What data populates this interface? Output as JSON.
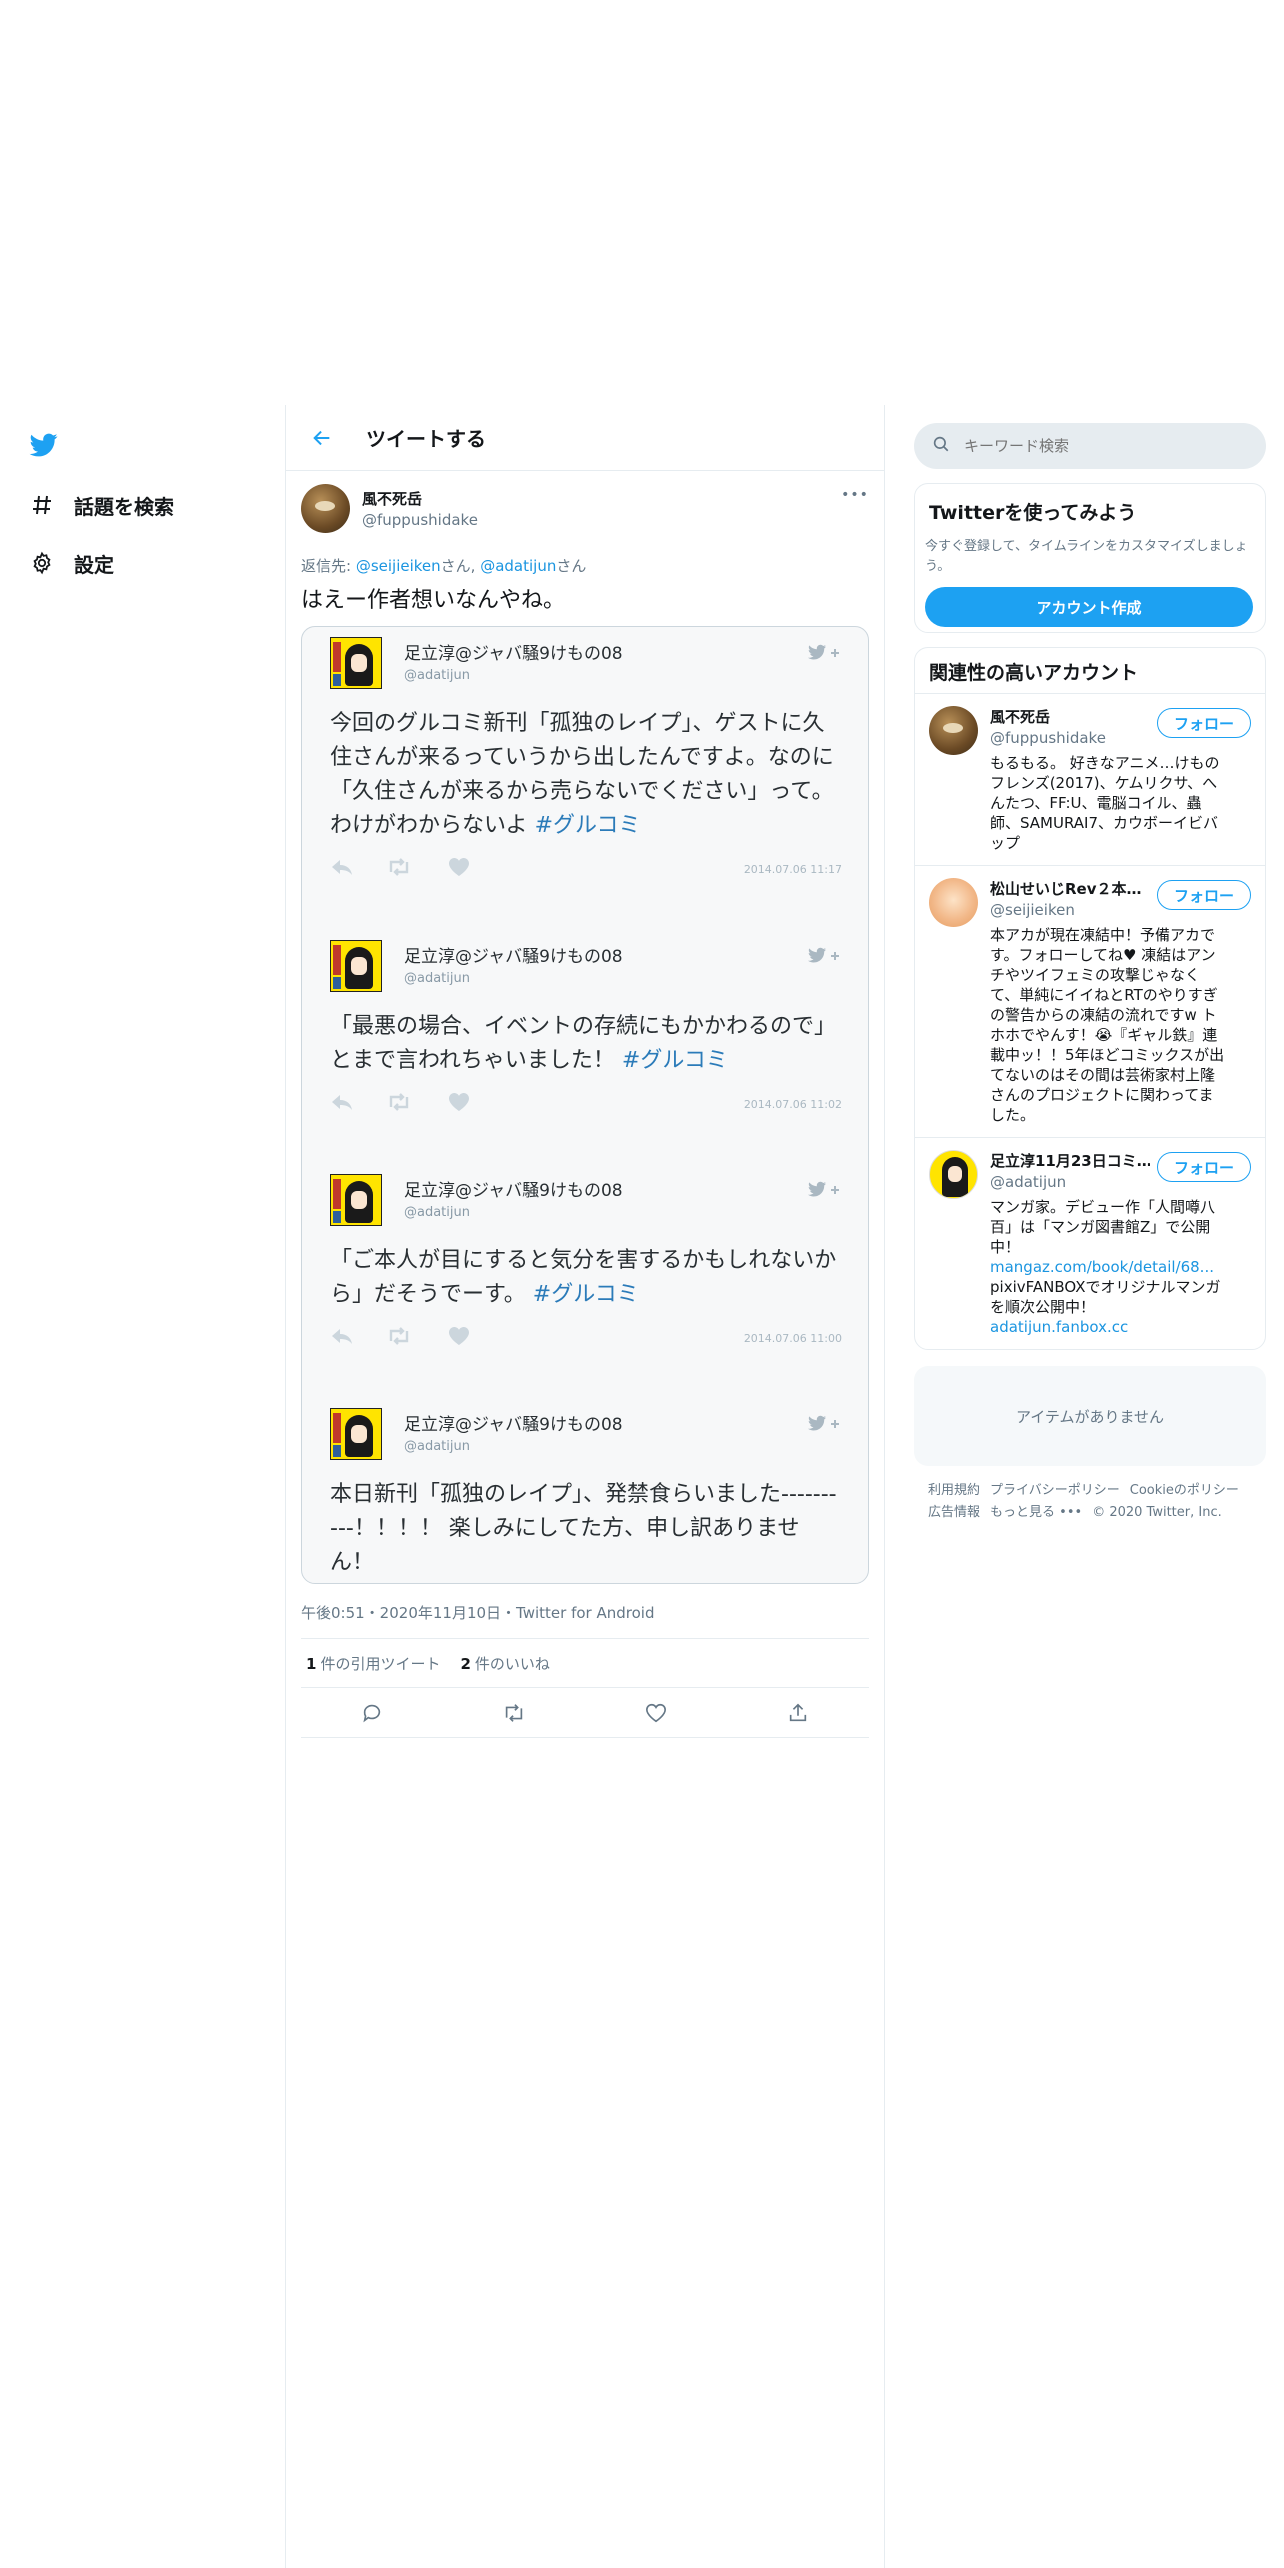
{
  "nav": {
    "explore_label": "話題を検索",
    "settings_label": "設定"
  },
  "header": {
    "title": "ツイートする"
  },
  "tweet": {
    "author_name": "風不死岳",
    "author_handle": "@fuppushidake",
    "more_glyph": "•••",
    "reply_prefix": "返信先: ",
    "reply_user1": "@seijieiken",
    "reply_suffix1": "さん, ",
    "reply_user2": "@adatijun",
    "reply_suffix2": "さん",
    "text": "はえー作者想いなんやね。",
    "timestamp": "午後0:51・2020年11月10日・",
    "source": "Twitter for Android",
    "quote_count": "1",
    "quote_label": "件の引用ツイート",
    "like_count": "2",
    "like_label": "件のいいね"
  },
  "embed": {
    "tweets": [
      {
        "name": "足立淳@ジャバ騒9けもの08",
        "handle": "@adatijun",
        "text": "今回のグルコミ新刊「孤独のレイプ」、ゲストに久住さんが来るっていうから出したんですよ。なのに「久住さんが来るから売らないでください」って。わけがわからないよ ",
        "hashtag": "#グルコミ",
        "time": "2014.07.06 11:17"
      },
      {
        "name": "足立淳@ジャバ騒9けもの08",
        "handle": "@adatijun",
        "text": "「最悪の場合、イベントの存続にもかかわるので」とまで言われちゃいました！ ",
        "hashtag": "#グルコミ",
        "time": "2014.07.06 11:02"
      },
      {
        "name": "足立淳@ジャバ騒9けもの08",
        "handle": "@adatijun",
        "text": "「ご本人が目にすると気分を害するかもしれないから」だそうでーす。 ",
        "hashtag": "#グルコミ",
        "time": "2014.07.06 11:00"
      },
      {
        "name": "足立淳@ジャバ騒9けもの08",
        "handle": "@adatijun",
        "text": "本日新刊「孤独のレイプ」、発禁食らいました----------！！！！ 楽しみにしてた方、申し訳ありません！",
        "hashtag": "",
        "time": ""
      }
    ]
  },
  "right": {
    "search_placeholder": "キーワード検索",
    "signup_title": "Twitterを使ってみよう",
    "signup_desc": "今すぐ登録して、タイムラインをカスタマイズしましょう。",
    "signup_button": "アカウント作成",
    "related_title": "関連性の高いアカウント",
    "follow_label": "フォロー",
    "accounts": [
      {
        "name": "風不死岳",
        "handle": "@fuppushidake",
        "bio": "もるもる。 好きなアニメ…けものフレンズ(2017)、ケムリクサ、へんたつ、FF:U、電脳コイル、蟲師、SAMURAI7、カウボーイビバップ"
      },
      {
        "name": "松山せいじRev２本…",
        "handle": "@seijieiken",
        "bio": "本アカが現在凍結中！予備アカです。フォローしてね♥ 凍結はアンチやツイフェミの攻撃じゃなくて、単純にイイねとRTのやりすぎの警告からの凍結の流れですw トホホでやんす！😭『ギャル鉄』連載中ッ！！5年ほどコミックスが出てないのはその間は芸術家村上隆さんのプロジェクトに関わってました。"
      },
      {
        "name": "足立淳11月23日コミ…",
        "handle": "@adatijun",
        "bio": "マンガ家。デビュー作「人間噂八百」は「マンガ図書館Z」で公開中！",
        "link1": "mangaz.com/book/detail/68...",
        "bio2": "pixivFANBOXでオリジナルマンガを順次公開中！ ",
        "link2": "adatijun.fanbox.cc"
      }
    ],
    "empty_text": "アイテムがありません",
    "footer": {
      "terms": "利用規約",
      "privacy": "プライバシーポリシー",
      "cookie": "Cookieのポリシー",
      "ads": "広告情報",
      "more": "もっと見る",
      "copyright": "© 2020 Twitter, Inc."
    }
  },
  "colors": {
    "accent": "#1da1f2",
    "link": "#1b95e0",
    "hashtag": "#2b7bb9"
  }
}
